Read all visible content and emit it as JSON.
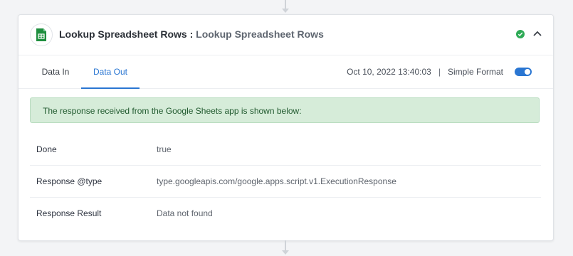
{
  "card": {
    "title": "Lookup Spreadsheet Rows",
    "separator": ":",
    "subtitle": "Lookup Spreadsheet Rows",
    "app_icon": "google-sheets-icon",
    "status_icon": "check-circle-icon",
    "collapse_icon": "chevron-up-icon"
  },
  "tabs": [
    {
      "label": "Data In",
      "active": false
    },
    {
      "label": "Data Out",
      "active": true
    }
  ],
  "meta": {
    "timestamp": "Oct 10, 2022 13:40:03",
    "separator": "|",
    "format_label": "Simple Format",
    "simple_format_enabled": true
  },
  "notice": {
    "text": "The response received from the Google Sheets app is shown below:"
  },
  "rows": [
    {
      "key": "Done",
      "value": "true"
    },
    {
      "key": "Response @type",
      "value": "type.googleapis.com/google.apps.script.v1.ExecutionResponse"
    },
    {
      "key": "Response Result",
      "value": "Data not found"
    }
  ],
  "colors": {
    "accent": "#2a76d2",
    "success": "#2eaa56",
    "notice_bg": "#d6ecd9",
    "sheets_green": "#1e8e3e"
  }
}
